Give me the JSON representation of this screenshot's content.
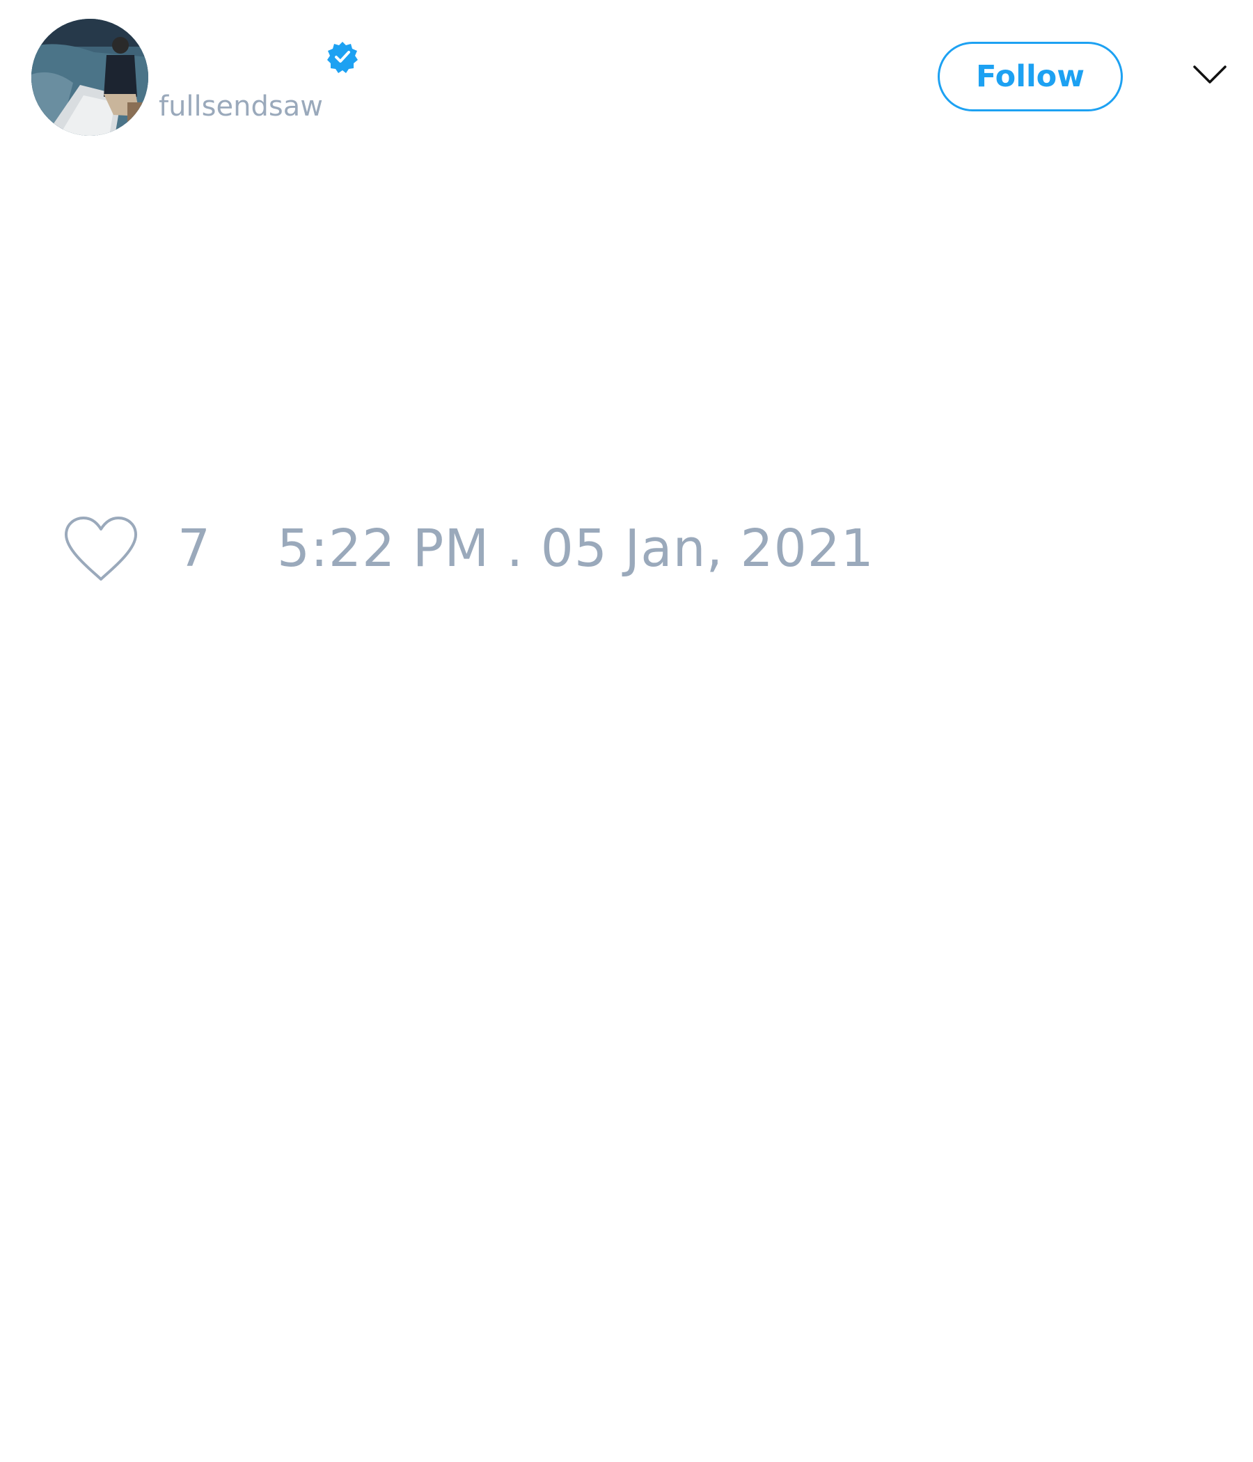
{
  "tweet": {
    "author": {
      "handle": "fullsendsaw",
      "verified": true,
      "avatar_icon": "profile-photo",
      "verified_icon": "verified-badge-icon"
    },
    "follow_label": "Follow",
    "menu_icon": "chevron-down-icon",
    "likes": {
      "icon": "heart-icon",
      "count": "7"
    },
    "timestamp": "5:22 PM . 05 Jan, 2021"
  },
  "colors": {
    "accent": "#1da1f2",
    "muted_text": "#9aa9bb",
    "background": "#ffffff"
  }
}
